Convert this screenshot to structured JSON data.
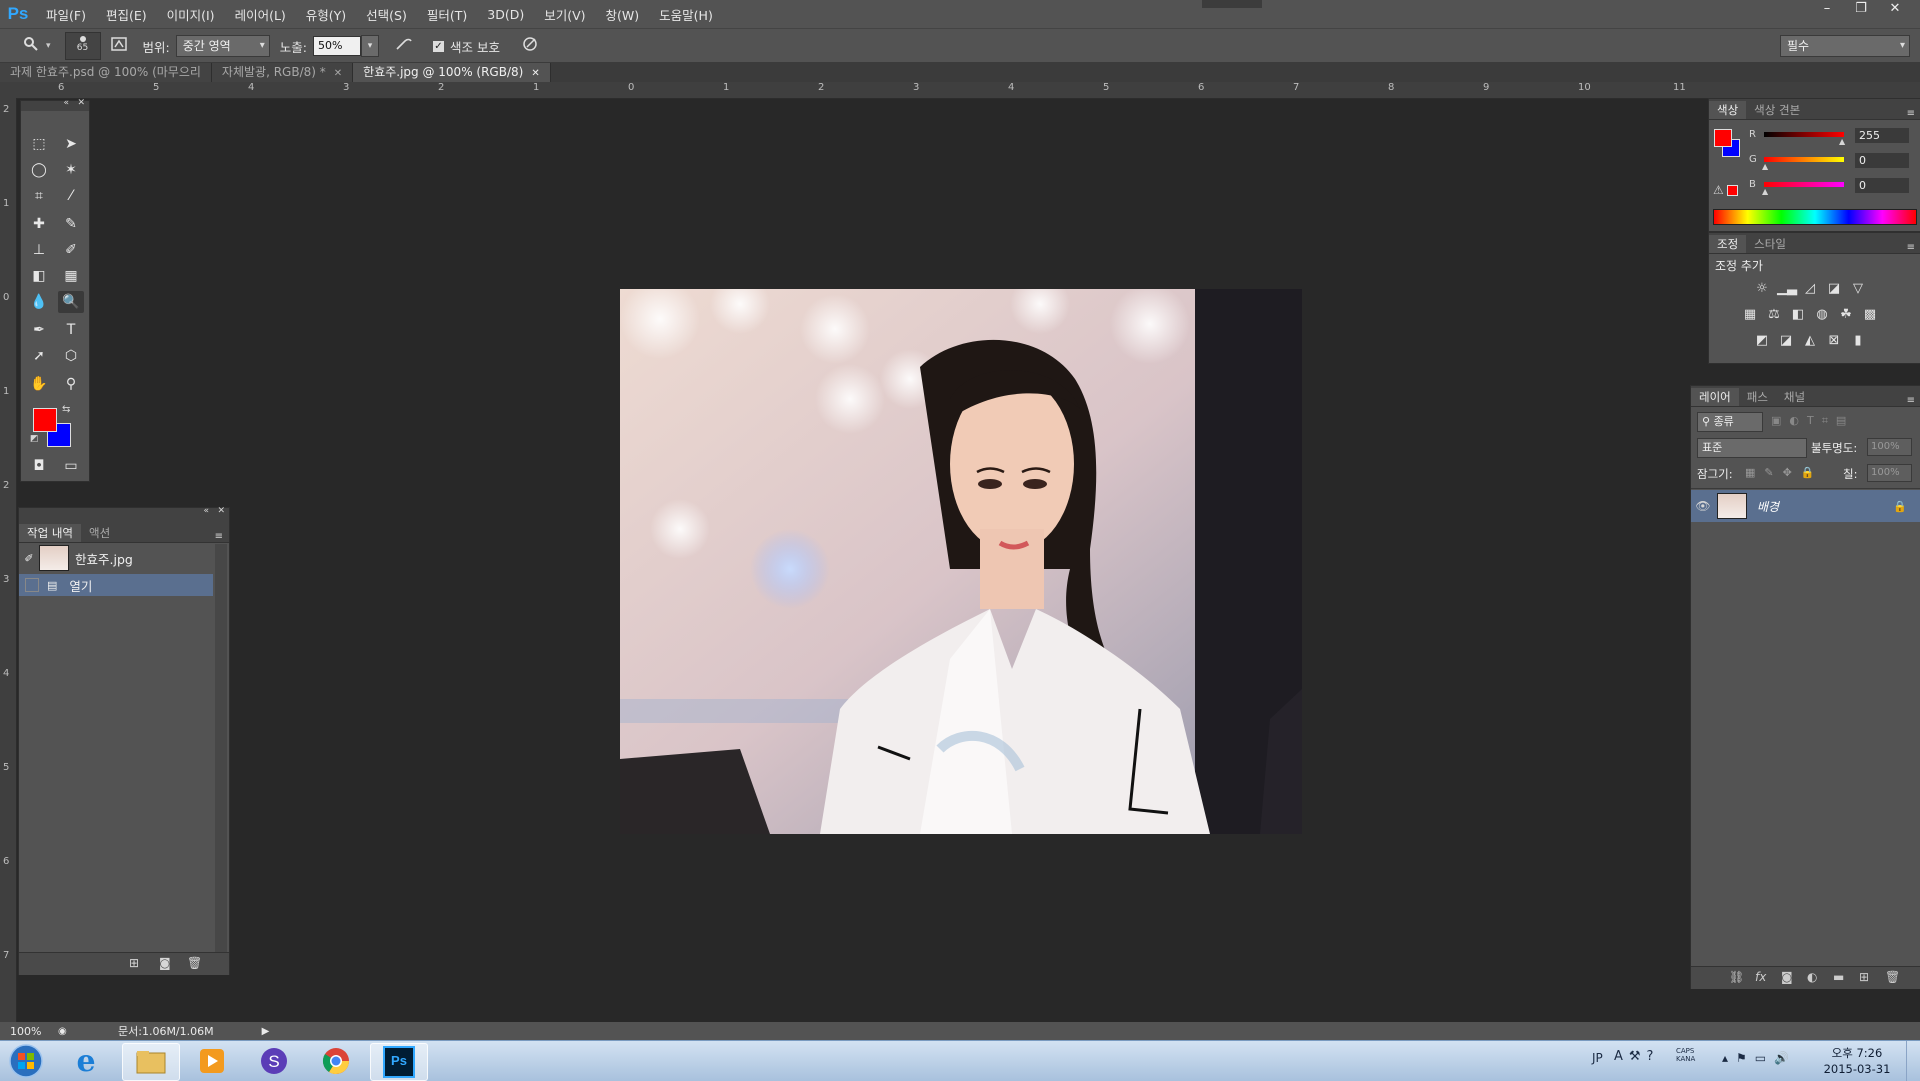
{
  "app": {
    "logo": "Ps"
  },
  "menu": [
    "파일(F)",
    "편집(E)",
    "이미지(I)",
    "레이어(L)",
    "유형(Y)",
    "선택(S)",
    "필터(T)",
    "3D(D)",
    "보기(V)",
    "창(W)",
    "도움말(H)"
  ],
  "window_controls": {
    "minimize": "–",
    "restore": "❐",
    "close": "✕"
  },
  "options": {
    "brush_size": "65",
    "range_label": "범위:",
    "range_value": "중간 영역",
    "exposure_label": "노출:",
    "exposure_value": "50%",
    "protect_tones_label": "색조 보호",
    "protect_tones_checked": true,
    "workspace": "필수"
  },
  "tabs": [
    {
      "label": "과제 한효주.psd @ 100% (마무으리",
      "active": false,
      "closable": false
    },
    {
      "label": "자체발광, RGB/8) *",
      "active": false,
      "closable": true
    },
    {
      "label": "한효주.jpg @ 100% (RGB/8)",
      "active": true,
      "closable": true
    }
  ],
  "ruler_top": [
    "6",
    "5",
    "4",
    "3",
    "2",
    "1",
    "0",
    "1",
    "2",
    "3",
    "4",
    "5",
    "6",
    "7",
    "8",
    "9",
    "10",
    "11"
  ],
  "ruler_left": [
    "2",
    "1",
    "0",
    "1",
    "2",
    "3",
    "4",
    "5",
    "6",
    "7"
  ],
  "toolbar": {
    "foreground_color": "#ff0000",
    "background_color": "#0000ff",
    "tools": [
      "marquee-icon",
      "move-icon",
      "lasso-icon",
      "magic-wand-icon",
      "crop-icon",
      "eyedropper-icon",
      "healing-brush-icon",
      "brush-icon",
      "clone-stamp-icon",
      "history-brush-icon",
      "eraser-icon",
      "gradient-icon",
      "dodge-icon",
      "burn-icon",
      "pen-icon",
      "type-icon",
      "path-select-icon",
      "shape-icon",
      "hand-icon",
      "zoom-icon"
    ]
  },
  "history": {
    "tabs": [
      "작업 내역",
      "액션"
    ],
    "snapshot": "한효주.jpg",
    "steps": [
      "열기"
    ]
  },
  "color_panel": {
    "tabs": [
      "색상",
      "색상 견본"
    ],
    "channels": [
      {
        "name": "R",
        "value": "255"
      },
      {
        "name": "G",
        "value": "0"
      },
      {
        "name": "B",
        "value": "0"
      }
    ]
  },
  "adjustments": {
    "tabs": [
      "조정",
      "스타일"
    ],
    "title": "조정 추가"
  },
  "layers": {
    "tabs": [
      "레이어",
      "패스",
      "채널"
    ],
    "filter": "종류",
    "blend_mode": "표준",
    "opacity_label": "불투명도:",
    "opacity_value": "100%",
    "lock_label": "잠그기:",
    "fill_label": "칠:",
    "fill_value": "100%",
    "items": [
      {
        "name": "배경",
        "visible": true,
        "locked": true
      }
    ]
  },
  "status": {
    "zoom": "100%",
    "doc": "문서:1.06M/1.06M"
  },
  "taskbar": {
    "apps": [
      "start-button",
      "internet-explorer-icon",
      "file-explorer-icon",
      "media-player-icon",
      "s-app-icon",
      "chrome-icon",
      "photoshop-icon"
    ],
    "tray_lang": "JP",
    "time": "오후 7:26",
    "date": "2015-03-31"
  }
}
